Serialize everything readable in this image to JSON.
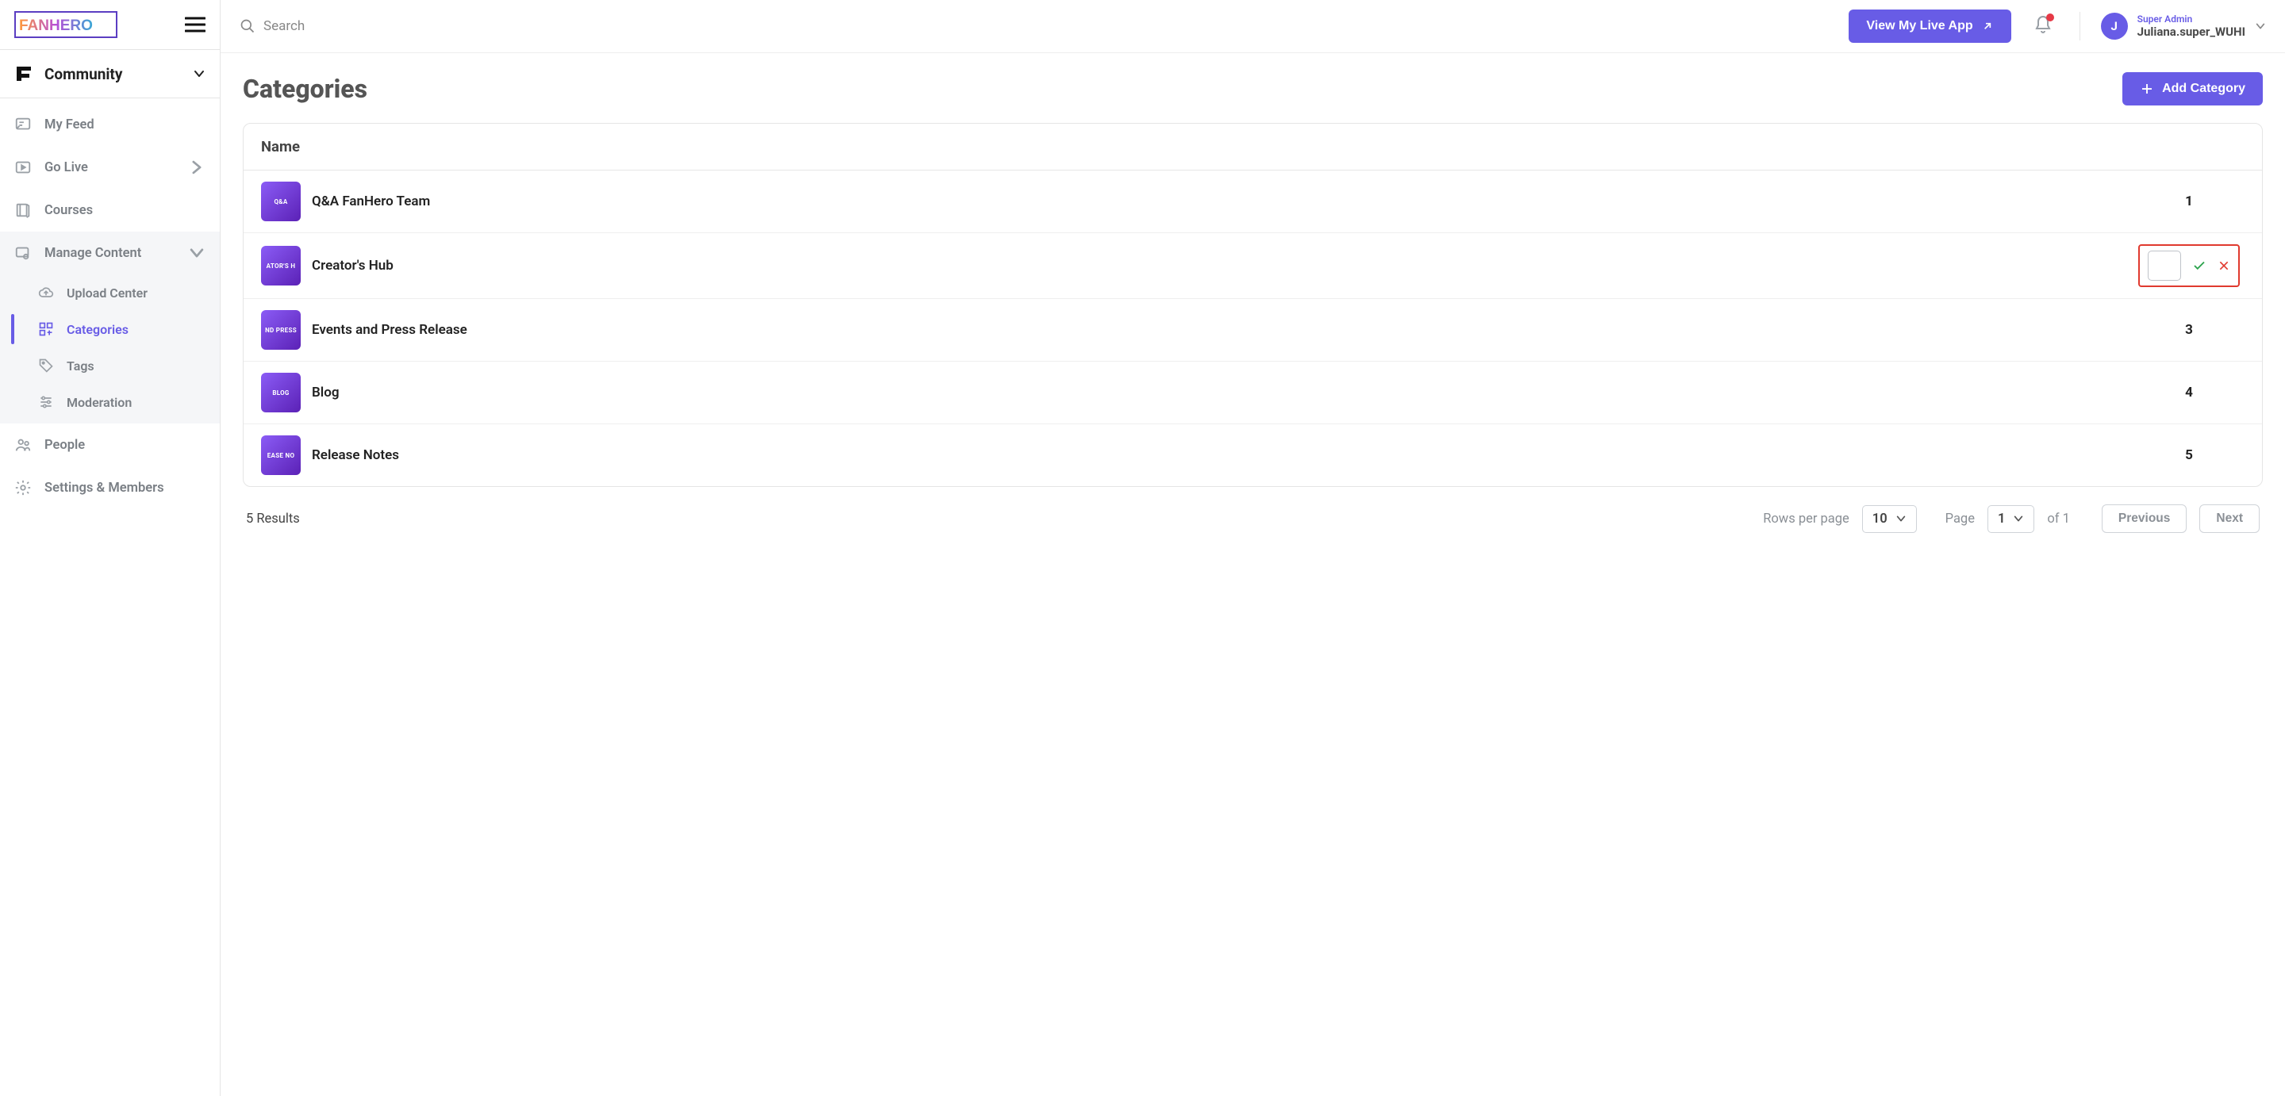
{
  "brand": "FANHERO",
  "community_label": "Community",
  "search_placeholder": "Search",
  "view_live_label": "View My Live App",
  "user": {
    "role": "Super Admin",
    "name": "Juliana.super_WUHI",
    "initial": "J"
  },
  "sidebar": {
    "items": [
      {
        "label": "My Feed"
      },
      {
        "label": "Go Live"
      },
      {
        "label": "Courses"
      },
      {
        "label": "Manage Content"
      },
      {
        "label": "People"
      },
      {
        "label": "Settings & Members"
      }
    ],
    "manage_sub": [
      {
        "label": "Upload Center"
      },
      {
        "label": "Categories"
      },
      {
        "label": "Tags"
      },
      {
        "label": "Moderation"
      }
    ]
  },
  "page": {
    "title": "Categories",
    "add_label": "Add Category",
    "col_name": "Name"
  },
  "rows": [
    {
      "thumb": "Q&A",
      "name": "Q&A FanHero Team",
      "count": "1",
      "editing": false
    },
    {
      "thumb": "ATOR'S H",
      "name": "Creator's Hub",
      "count": "",
      "editing": true
    },
    {
      "thumb": "ND PRESS",
      "name": "Events and Press Release",
      "count": "3",
      "editing": false
    },
    {
      "thumb": "BLOG",
      "name": "Blog",
      "count": "4",
      "editing": false
    },
    {
      "thumb": "EASE NO",
      "name": "Release Notes",
      "count": "5",
      "editing": false
    }
  ],
  "footer": {
    "results": "5 Results",
    "rpp_label": "Rows per page",
    "rpp_value": "10",
    "page_label": "Page",
    "page_value": "1",
    "of_label": "of 1",
    "prev": "Previous",
    "next": "Next"
  }
}
